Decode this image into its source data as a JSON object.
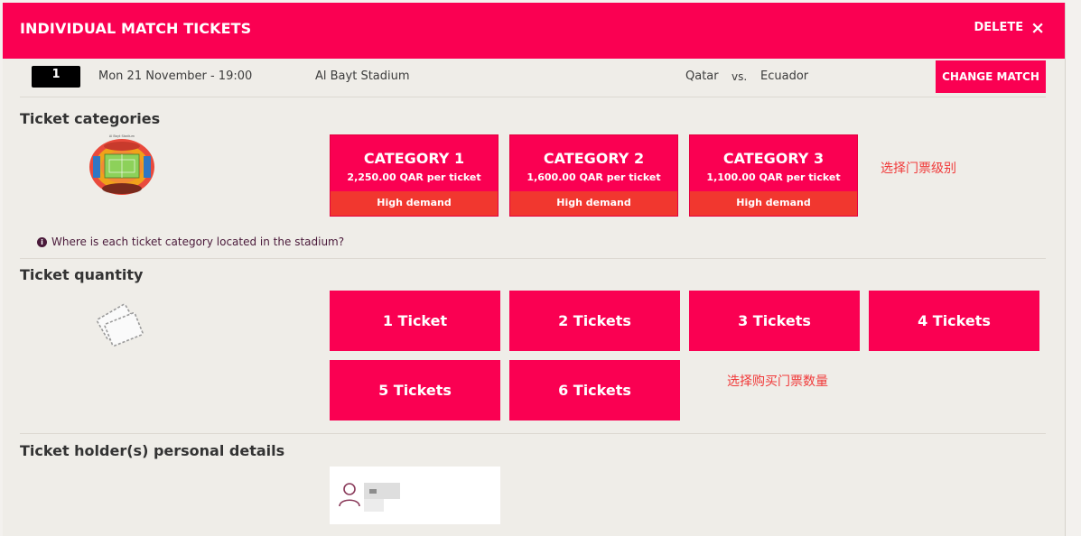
{
  "header": {
    "title": "INDIVIDUAL MATCH TICKETS",
    "delete_label": "DELETE",
    "delete_icon": "×"
  },
  "match": {
    "number": "1",
    "datetime": "Mon 21 November - 19:00",
    "venue": "Al Bayt Stadium",
    "home_team": "Qatar",
    "vs": "vs.",
    "away_team": "Ecuador",
    "change_label": "CHANGE MATCH"
  },
  "categories_section": {
    "title": "Ticket categories",
    "items": [
      {
        "name": "CATEGORY 1",
        "price": "2,250.00 QAR per ticket",
        "demand": "High demand"
      },
      {
        "name": "CATEGORY 2",
        "price": "1,600.00 QAR per ticket",
        "demand": "High demand"
      },
      {
        "name": "CATEGORY 3",
        "price": "1,100.00 QAR per ticket",
        "demand": "High demand"
      }
    ],
    "note": "选择门票级别",
    "where_link": "Where is each ticket category located in the stadium?",
    "stadium_image_caption": "Al Bayt Stadium"
  },
  "quantity_section": {
    "title": "Ticket quantity",
    "options": [
      "1 Ticket",
      "2 Tickets",
      "3 Tickets",
      "4 Tickets",
      "5 Tickets",
      "6 Tickets"
    ],
    "note": "选择购买门票数量"
  },
  "holders_section": {
    "title": "Ticket holder(s) personal details"
  },
  "colors": {
    "brand": "#fa0052",
    "demand": "#f1372f",
    "annotation": "#f03a3a"
  }
}
